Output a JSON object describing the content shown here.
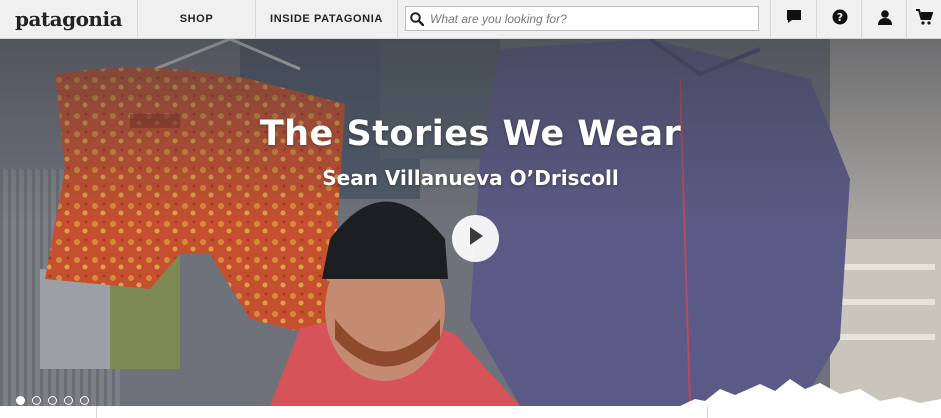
{
  "header": {
    "logo": "patagonia",
    "nav": [
      {
        "label": "SHOP"
      },
      {
        "label": "INSIDE PATAGONIA"
      }
    ],
    "search": {
      "placeholder": "What are you looking for?",
      "value": ""
    },
    "utility_icons": [
      "chat-icon",
      "help-icon",
      "account-icon",
      "cart-icon"
    ]
  },
  "hero": {
    "title": "The Stories We Wear",
    "subtitle": "Sean Villanueva O’Driscoll",
    "play_icon": "play-icon",
    "carousel": {
      "count": 5,
      "active_index": 1
    }
  },
  "colors": {
    "topbar_bg": "#f0f0f0",
    "text_dark": "#222222",
    "hero_text": "#ffffff"
  }
}
